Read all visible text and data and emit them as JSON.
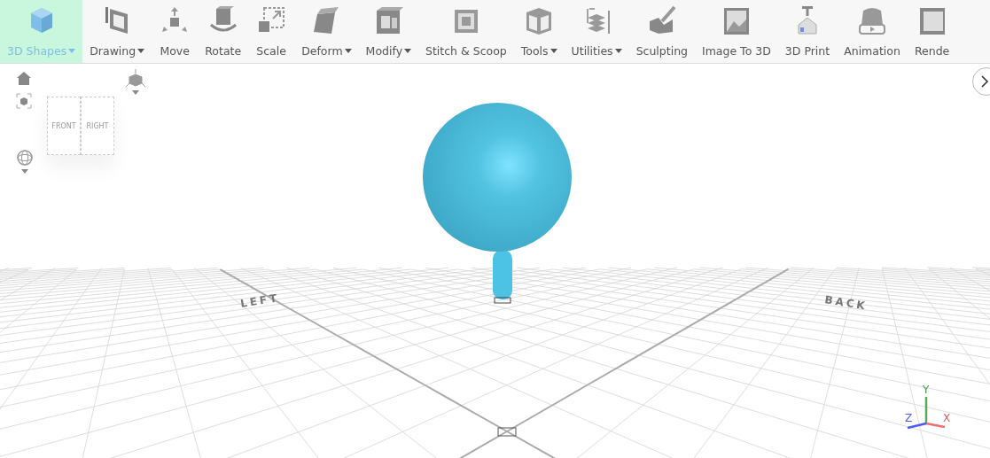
{
  "toolbar": [
    {
      "label": "3D Shapes",
      "dropdown": true,
      "selected": true
    },
    {
      "label": "Drawing",
      "dropdown": true,
      "selected": false
    },
    {
      "label": "Move",
      "dropdown": false,
      "selected": false
    },
    {
      "label": "Rotate",
      "dropdown": false,
      "selected": false
    },
    {
      "label": "Scale",
      "dropdown": false,
      "selected": false
    },
    {
      "label": "Deform",
      "dropdown": true,
      "selected": false
    },
    {
      "label": "Modify",
      "dropdown": true,
      "selected": false
    },
    {
      "label": "Stitch & Scoop",
      "dropdown": false,
      "selected": false
    },
    {
      "label": "Tools",
      "dropdown": true,
      "selected": false
    },
    {
      "label": "Utilities",
      "dropdown": true,
      "selected": false
    },
    {
      "label": "Sculpting",
      "dropdown": false,
      "selected": false
    },
    {
      "label": "Image To 3D",
      "dropdown": false,
      "selected": false
    },
    {
      "label": "3D Print",
      "dropdown": false,
      "selected": false
    },
    {
      "label": "Animation",
      "dropdown": false,
      "selected": false
    },
    {
      "label": "Rende",
      "dropdown": false,
      "selected": false
    }
  ],
  "view_cube": {
    "faces": [
      "FRONT",
      "RIGHT"
    ]
  },
  "scene": {
    "grid_labels": [
      "LEFT",
      "BACK"
    ],
    "axes": [
      "X",
      "Y",
      "Z"
    ]
  }
}
